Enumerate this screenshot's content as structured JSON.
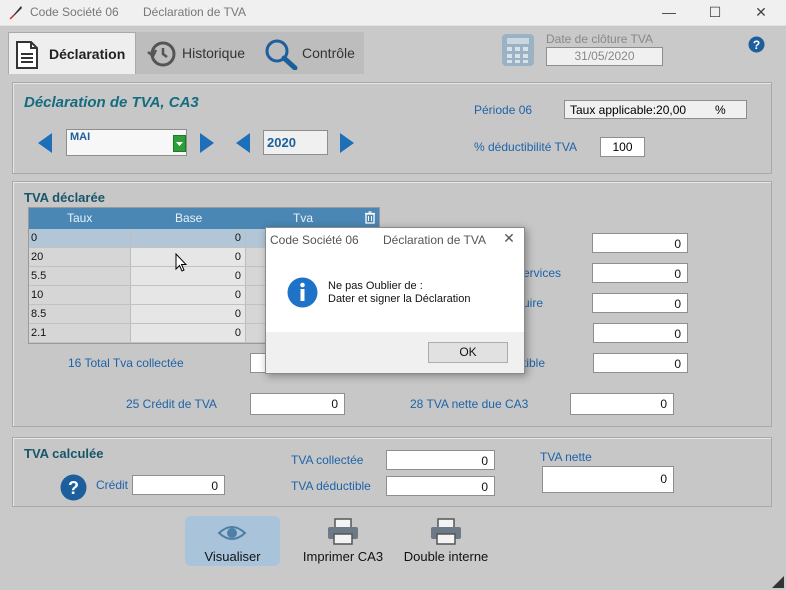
{
  "window": {
    "company": "Code Société 06",
    "title": "Déclaration de TVA"
  },
  "tabs": [
    {
      "label": "Déclaration",
      "icon": "document-icon",
      "active": true
    },
    {
      "label": "Historique",
      "icon": "history-clock-icon",
      "active": false
    },
    {
      "label": "Contrôle",
      "icon": "magnifier-icon",
      "active": false
    }
  ],
  "closing": {
    "label": "Date de clôture TVA",
    "value": "31/05/2020"
  },
  "header_panel": {
    "title": "Déclaration de TVA, CA3",
    "month": "MAI",
    "year": "2020",
    "period_label": "Période 06",
    "rate_text": "Taux applicable:20,00",
    "rate_unit": "%",
    "deductibility_label": "% déductibilité TVA",
    "deductibility_value": "100"
  },
  "declared": {
    "title": "TVA déclarée",
    "columns": [
      "Taux",
      "Base",
      "Tva"
    ],
    "rows": [
      {
        "taux": "0",
        "base": "0"
      },
      {
        "taux": "20",
        "base": "0"
      },
      {
        "taux": "5.5",
        "base": "0"
      },
      {
        "taux": "10",
        "base": "0"
      },
      {
        "taux": "8.5",
        "base": "0"
      },
      {
        "taux": "2.1",
        "base": "0"
      }
    ],
    "right_fields": [
      {
        "label": "",
        "value": "0"
      },
      {
        "label": "ervices",
        "value": "0"
      },
      {
        "label": "uire",
        "value": "0"
      },
      {
        "label": "",
        "value": "0"
      },
      {
        "label": "tible",
        "value": "0"
      }
    ],
    "total_collected_label": "16 Total Tva collectée",
    "credit_label": "25 Crédit de TVA",
    "credit_value": "0",
    "net_due_label": "28 TVA nette due CA3",
    "net_due_value": "0"
  },
  "computed": {
    "title": "TVA calculée",
    "credit_label": "Crédit",
    "credit_value": "0",
    "collected_label": "TVA collectée",
    "collected_value": "0",
    "deductible_label": "TVA déductible",
    "deductible_value": "0",
    "net_label": "TVA nette",
    "net_value": "0"
  },
  "actions": {
    "visualize": "Visualiser",
    "print_ca3": "Imprimer CA3",
    "double": "Double interne"
  },
  "dialog": {
    "company": "Code Société 06",
    "title": "Déclaration de TVA",
    "line1": "Ne pas Oublier de :",
    "line2": "Dater et signer la Déclaration",
    "ok": "OK"
  },
  "colors": {
    "accent_blue": "#1d6fb8",
    "grid_header": "#4a87b5",
    "title_teal": "#156c80",
    "dropdown_green": "#2e9e3a"
  }
}
